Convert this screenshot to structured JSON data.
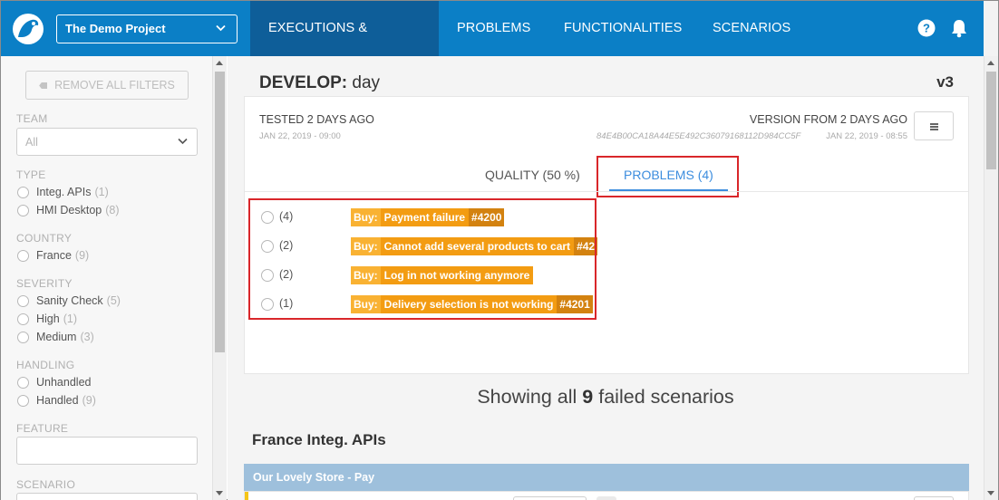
{
  "header": {
    "project_select": "The Demo Project",
    "nav": [
      "EXECUTIONS & ERRORS",
      "PROBLEMS",
      "FUNCTIONALITIES",
      "SCENARIOS"
    ],
    "active_nav": "EXECUTIONS & ERRORS",
    "icons": [
      "logo-icon",
      "help-icon",
      "bell-icon"
    ],
    "bar_color": "#0b7fc6",
    "active_color": "#0e5e99"
  },
  "sidebar": {
    "remove_filters": "REMOVE ALL FILTERS",
    "team": {
      "label": "TEAM",
      "value": "All"
    },
    "type": {
      "label": "TYPE",
      "items": [
        {
          "label": "Integ. APIs",
          "count": "(1)"
        },
        {
          "label": "HMI Desktop",
          "count": "(8)"
        }
      ]
    },
    "country": {
      "label": "COUNTRY",
      "items": [
        {
          "label": "France",
          "count": "(9)"
        }
      ]
    },
    "severity": {
      "label": "SEVERITY",
      "items": [
        {
          "label": "Sanity Check",
          "count": "(5)"
        },
        {
          "label": "High",
          "count": "(1)"
        },
        {
          "label": "Medium",
          "count": "(3)"
        }
      ]
    },
    "handling": {
      "label": "HANDLING",
      "items": [
        {
          "label": "Unhandled",
          "count": ""
        },
        {
          "label": "Handled",
          "count": "(9)"
        }
      ]
    },
    "feature": {
      "label": "FEATURE"
    },
    "scenario": {
      "label": "SCENARIO"
    }
  },
  "run": {
    "branch": "DEVELOP:",
    "cycle": "day",
    "version": "v3",
    "tested": "TESTED 2 DAYS AGO",
    "tested_date": "JAN 22, 2019 - 09:00",
    "version_from": "VERSION FROM 2 DAYS AGO",
    "version_hash": "84E4B00CA18A44E5E492C36079168112D984CC5F",
    "version_date": "JAN 22, 2019 - 08:55",
    "tabs": {
      "quality": "QUALITY (50 %)",
      "problems": "PROBLEMS (4)"
    },
    "problems": [
      {
        "count": "(4)",
        "type": "Buy:",
        "name": "Payment failure",
        "number": "#4200"
      },
      {
        "count": "(2)",
        "type": "Buy:",
        "name": "Cannot add several products to cart",
        "number": "#42"
      },
      {
        "count": "(2)",
        "type": "Buy:",
        "name": "Log in not working anymore",
        "number": ""
      },
      {
        "count": "(1)",
        "type": "Buy:",
        "name": "Delivery selection is not working",
        "number": "#4201"
      }
    ],
    "highlight_color": "#d9262a"
  },
  "results": {
    "showing_prefix": "Showing all",
    "showing_count": "9",
    "showing_suffix": "failed scenarios",
    "group_title": "France Integ. APIs",
    "group_header": "Our Lovely Store - Pay"
  }
}
